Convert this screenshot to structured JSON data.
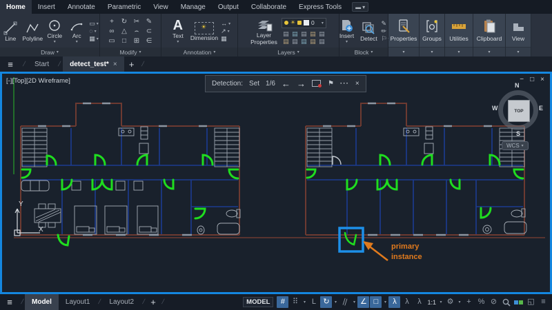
{
  "menu": {
    "tabs": [
      "Home",
      "Insert",
      "Annotate",
      "Parametric",
      "View",
      "Manage",
      "Output",
      "Collaborate",
      "Express Tools"
    ]
  },
  "ribbon": {
    "draw": {
      "label": "Draw",
      "line": "Line",
      "polyline": "Polyline",
      "circle": "Circle",
      "arc": "Arc"
    },
    "modify": {
      "label": "Modify",
      "glyphs": [
        "+",
        "↻",
        "✂",
        "✎",
        "∞",
        "△",
        "⌢",
        "⊂",
        "▭",
        "□",
        "⊞",
        "∈"
      ]
    },
    "annotation": {
      "label": "Annotation",
      "text": "Text",
      "dimension": "Dimension"
    },
    "layers": {
      "label": "Layers",
      "layer_properties_1": "Layer",
      "layer_properties_2": "Properties",
      "current_layer": "0"
    },
    "block": {
      "label": "Block",
      "insert": "Insert",
      "detect": "Detect"
    },
    "panels": {
      "properties": "Properties",
      "groups": "Groups",
      "utilities": "Utilities",
      "clipboard": "Clipboard",
      "view": "View"
    }
  },
  "file_tabs": {
    "start": "Start",
    "active": "detect_test*"
  },
  "viewport": {
    "label": "[-][Top][2D Wireframe]"
  },
  "detection": {
    "label": "Detection:",
    "set": "Set",
    "count": "1/6"
  },
  "viewcube": {
    "n": "N",
    "w": "W",
    "e": "E",
    "s": "S",
    "top": "TOP",
    "wcs": "WCS"
  },
  "callout": {
    "line1": "primary",
    "line2": "instance"
  },
  "drawing": {
    "ucs_x": "X",
    "ucs_y": "Y"
  },
  "layout_tabs": {
    "model": "Model",
    "layout1": "Layout1",
    "layout2": "Layout2"
  },
  "status": {
    "model": "MODEL",
    "scale": "1:1"
  },
  "icons": {
    "hamburger": "≡",
    "plus": "+",
    "close": "×",
    "caret": "▾",
    "slash": "/",
    "back": "←",
    "forward": "→",
    "dots": "···",
    "flag": "⚑",
    "minimize": "−",
    "restore": "□",
    "grid": "#",
    "snap": "⠿",
    "ortho": "L",
    "polar": "↻",
    "iso": "||",
    "otrack": "∠",
    "osnap": "□",
    "annot": "λ",
    "gear": "⚙",
    "cycle": "%",
    "isolate": "⊘",
    "clean": "◱",
    "ribbon_toggle": "▬",
    "sun": "☀",
    "star": "*",
    "draw_extra": [
      "▭",
      "◌",
      "▦"
    ],
    "annot_extra": [
      "↔",
      "↗",
      "▦"
    ],
    "block_extra": [
      "✎",
      "✏",
      "⚐"
    ],
    "layer_chip": "▤"
  },
  "colors": {
    "accent_blue": "#1487e0",
    "instance_green": "#1fdd1f",
    "callout_orange": "#e07a1d",
    "wall_maroon": "#6d3a31",
    "partition_navy": "#1c3c92"
  }
}
